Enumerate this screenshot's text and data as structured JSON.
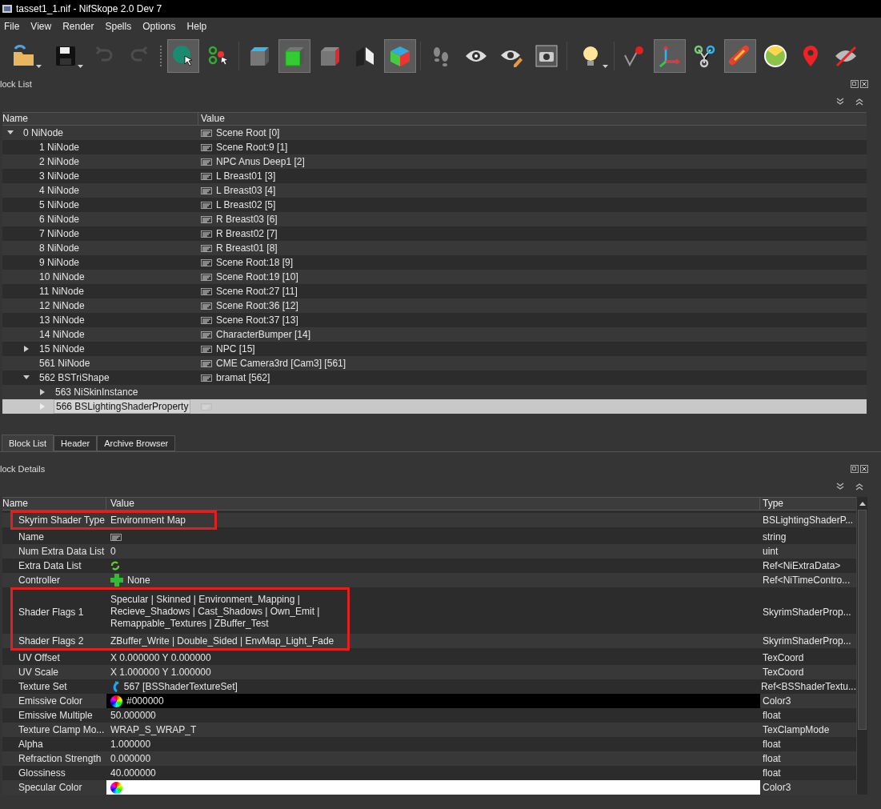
{
  "window": {
    "title": "tasset1_1.nif - NifSkope 2.0 Dev 7"
  },
  "menu": [
    "File",
    "View",
    "Render",
    "Spells",
    "Options",
    "Help"
  ],
  "toolbar": [
    {
      "kind": "open",
      "pressed": false,
      "disabled": false,
      "has_menu": true
    },
    {
      "kind": "save",
      "pressed": false,
      "disabled": false,
      "has_menu": true
    },
    {
      "kind": "undo",
      "pressed": false,
      "disabled": true,
      "has_menu": false
    },
    {
      "kind": "redo",
      "pressed": false,
      "disabled": true,
      "has_menu": false
    },
    {
      "kind": "grip"
    },
    {
      "kind": "select",
      "pressed": true,
      "disabled": false,
      "has_menu": false
    },
    {
      "kind": "select-multi",
      "pressed": false,
      "disabled": false,
      "has_menu": false
    },
    {
      "kind": "separator"
    },
    {
      "kind": "cube-top",
      "pressed": false,
      "disabled": false,
      "has_menu": false
    },
    {
      "kind": "cube-front",
      "pressed": true,
      "disabled": false,
      "has_menu": false
    },
    {
      "kind": "cube-side",
      "pressed": false,
      "disabled": false,
      "has_menu": false
    },
    {
      "kind": "cube-split",
      "pressed": false,
      "disabled": false,
      "has_menu": false
    },
    {
      "kind": "cube-color",
      "pressed": true,
      "disabled": false,
      "has_menu": false
    },
    {
      "kind": "separator"
    },
    {
      "kind": "footprints",
      "pressed": false,
      "disabled": false,
      "has_menu": false
    },
    {
      "kind": "eye",
      "pressed": false,
      "disabled": false,
      "has_menu": false
    },
    {
      "kind": "eye-edit",
      "pressed": false,
      "disabled": false,
      "has_menu": false
    },
    {
      "kind": "camera",
      "pressed": false,
      "disabled": false,
      "has_menu": false
    },
    {
      "kind": "separator"
    },
    {
      "kind": "bulb",
      "pressed": false,
      "disabled": false,
      "has_menu": true
    },
    {
      "kind": "separator"
    },
    {
      "kind": "vertex",
      "pressed": false,
      "disabled": false,
      "has_menu": false
    },
    {
      "kind": "axes",
      "pressed": true,
      "disabled": false,
      "has_menu": false
    },
    {
      "kind": "nodes",
      "pressed": false,
      "disabled": false,
      "has_menu": false
    },
    {
      "kind": "bone",
      "pressed": true,
      "disabled": false,
      "has_menu": false
    },
    {
      "kind": "gauge",
      "pressed": false,
      "disabled": false,
      "has_menu": false
    },
    {
      "kind": "marker",
      "pressed": false,
      "disabled": false,
      "has_menu": false
    },
    {
      "kind": "eye-off",
      "pressed": false,
      "disabled": false,
      "has_menu": false
    }
  ],
  "block_list": {
    "title": "lock List",
    "columns": [
      "Name",
      "Value"
    ],
    "tree": [
      {
        "name": "0 NiNode",
        "value": "Scene Root [0]",
        "txt_icon": true,
        "expanded": true,
        "selected": false,
        "children": [
          {
            "name": "1 NiNode",
            "value": "Scene Root:9 [1]",
            "txt_icon": true,
            "selected": false
          },
          {
            "name": "2 NiNode",
            "value": "NPC Anus Deep1 [2]",
            "txt_icon": true,
            "selected": false
          },
          {
            "name": "3 NiNode",
            "value": "L Breast01 [3]",
            "txt_icon": true,
            "selected": false
          },
          {
            "name": "4 NiNode",
            "value": "L Breast03 [4]",
            "txt_icon": true,
            "selected": false
          },
          {
            "name": "5 NiNode",
            "value": "L Breast02 [5]",
            "txt_icon": true,
            "selected": false
          },
          {
            "name": "6 NiNode",
            "value": "R Breast03 [6]",
            "txt_icon": true,
            "selected": false
          },
          {
            "name": "7 NiNode",
            "value": "R Breast02 [7]",
            "txt_icon": true,
            "selected": false
          },
          {
            "name": "8 NiNode",
            "value": "R Breast01 [8]",
            "txt_icon": true,
            "selected": false
          },
          {
            "name": "9 NiNode",
            "value": "Scene Root:18 [9]",
            "txt_icon": true,
            "selected": false
          },
          {
            "name": "10 NiNode",
            "value": "Scene Root:19 [10]",
            "txt_icon": true,
            "selected": false
          },
          {
            "name": "11 NiNode",
            "value": "Scene Root:27 [11]",
            "txt_icon": true,
            "selected": false
          },
          {
            "name": "12 NiNode",
            "value": "Scene Root:36 [12]",
            "txt_icon": true,
            "selected": false
          },
          {
            "name": "13 NiNode",
            "value": "Scene Root:37 [13]",
            "txt_icon": true,
            "selected": false
          },
          {
            "name": "14 NiNode",
            "value": "CharacterBumper [14]",
            "txt_icon": true,
            "selected": false
          },
          {
            "name": "15 NiNode",
            "value": "NPC [15]",
            "txt_icon": true,
            "expanded": false,
            "selected": false
          },
          {
            "name": "561 NiNode",
            "value": "CME Camera3rd [Cam3] [561]",
            "txt_icon": true,
            "selected": false
          },
          {
            "name": "562 BSTriShape",
            "value": "bramat [562]",
            "txt_icon": true,
            "expanded": true,
            "selected": false,
            "children": [
              {
                "name": "563 NiSkinInstance",
                "txt_icon": false,
                "expanded": false,
                "selected": false
              },
              {
                "name": "566 BSLightingShaderProperty",
                "txt_icon": true,
                "expanded": false,
                "selected": true
              }
            ]
          }
        ]
      }
    ]
  },
  "tabs": [
    {
      "label": "Block List",
      "selected": true
    },
    {
      "label": "Header",
      "selected": false
    },
    {
      "label": "Archive Browser",
      "selected": false
    }
  ],
  "block_details": {
    "title": "lock Details",
    "columns": [
      "Name",
      "Value",
      "Type"
    ],
    "rows": [
      {
        "outlined": true,
        "rows": [
          {
            "name": "Skyrim Shader Type",
            "value": "Environment Map",
            "type": "BSLightingShaderP...",
            "kind": "plain"
          }
        ]
      },
      {
        "outlined": false,
        "rows": [
          {
            "name": "Name",
            "type": "string",
            "kind": "text"
          },
          {
            "name": "Num Extra Data List",
            "value": "0",
            "type": "uint",
            "kind": "plain"
          },
          {
            "name": "Extra Data List",
            "type": "Ref<NiExtraData>",
            "kind": "list"
          },
          {
            "name": "Controller",
            "value": "None",
            "type": "Ref<NiTimeContro...",
            "kind": "add"
          }
        ]
      },
      {
        "outlined": true,
        "rows": [
          {
            "name": "Shader Flags 1",
            "value": "Specular | Skinned | Environment_Mapping |\nRecieve_Shadows | Cast_Shadows | Own_Emit |\nRemappable_Textures | ZBuffer_Test",
            "type": "SkyrimShaderProp...",
            "kind": "plain"
          },
          {
            "name": "Shader Flags 2",
            "value": "ZBuffer_Write | Double_Sided | EnvMap_Light_Fade",
            "type": "SkyrimShaderProp...",
            "kind": "plain"
          }
        ]
      },
      {
        "outlined": false,
        "rows": [
          {
            "name": "UV Offset",
            "value": "X 0.000000 Y 0.000000",
            "type": "TexCoord",
            "kind": "plain"
          },
          {
            "name": "UV Scale",
            "value": "X 1.000000 Y 1.000000",
            "type": "TexCoord",
            "kind": "plain"
          },
          {
            "name": "Texture Set",
            "value": "567 [BSShaderTextureSet]",
            "type": "Ref<BSShaderTextu...",
            "kind": "ref"
          },
          {
            "name": "Emissive Color",
            "value": "#000000",
            "type": "Color3",
            "kind": "color",
            "color": "#000000"
          },
          {
            "name": "Emissive Multiple",
            "value": "50.000000",
            "type": "float",
            "kind": "plain"
          },
          {
            "name": "Texture Clamp Mo...",
            "value": "WRAP_S_WRAP_T",
            "type": "TexClampMode",
            "kind": "plain"
          },
          {
            "name": "Alpha",
            "value": "1.000000",
            "type": "float",
            "kind": "plain"
          },
          {
            "name": "Refraction Strength",
            "value": "0.000000",
            "type": "float",
            "kind": "plain"
          },
          {
            "name": "Glossiness",
            "value": "40.000000",
            "type": "float",
            "kind": "plain"
          },
          {
            "name": "Specular Color",
            "type": "Color3",
            "kind": "color",
            "color": "#ffffff"
          }
        ]
      }
    ]
  }
}
